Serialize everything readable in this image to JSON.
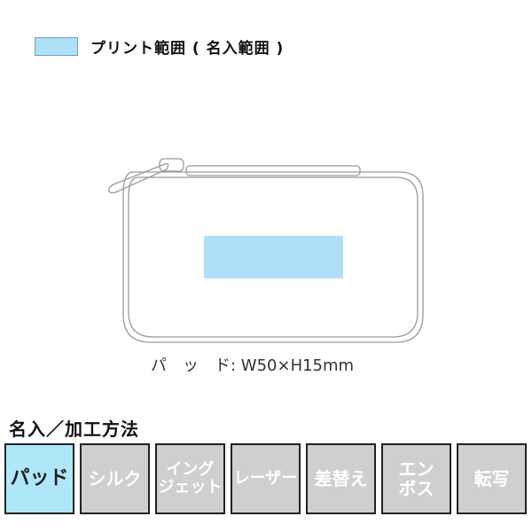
{
  "legend": {
    "label": "プリント範囲 ( 名入範囲 )",
    "swatch_color": "#aee0f8"
  },
  "product": {
    "name": "pouch-with-zipper",
    "print_area_color": "#aee0f8",
    "size_label": "パ　ッ　ド: W50×H15mm"
  },
  "methods_section": {
    "title": "名入／加工方法",
    "items": [
      {
        "label": "パッド",
        "active": true
      },
      {
        "label": "シルク",
        "active": false
      },
      {
        "label": "イング\nジェット",
        "active": false
      },
      {
        "label": "レーザー",
        "active": false
      },
      {
        "label": "差替え",
        "active": false
      },
      {
        "label": "エン\nボス",
        "active": false
      },
      {
        "label": "転写",
        "active": false
      }
    ]
  }
}
